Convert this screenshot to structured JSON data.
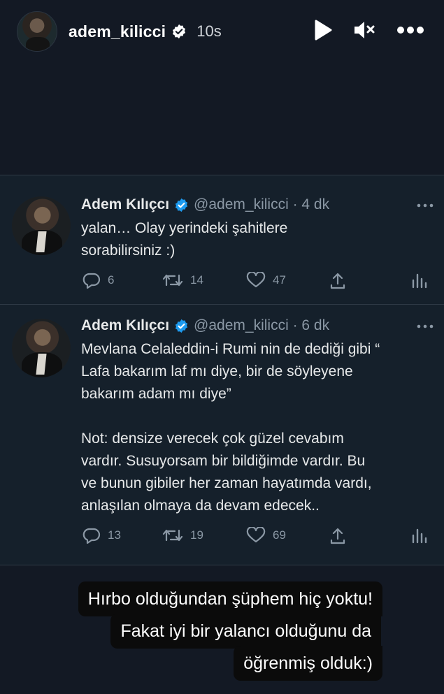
{
  "story": {
    "username": "adem_kilicci",
    "time": "10s",
    "icons": [
      "play-icon",
      "mute-icon",
      "more-options-icon"
    ]
  },
  "tweets": [
    {
      "name": "Adem Kılıçcı",
      "handle_time": "@adem_kilicci · 4 dk",
      "text": "yalan… Olay yerindeki şahitlere\nsorabilirsiniz :)",
      "replies": "6",
      "retweets": "14",
      "likes": "47"
    },
    {
      "name": "Adem Kılıçcı",
      "handle_time": "@adem_kilicci · 6 dk",
      "text": "Mevlana Celaleddin-i Rumi nin de dediği gibi “\nLafa bakarım laf mı diye, bir de söyleyene\nbakarım adam mı diye”\n\nNot: densize verecek çok güzel cevabım\nvardır. Susuyorsam bir bildiğimde vardır. Bu\nve bunun gibiler her zaman hayatımda vardı,\nanlaşılan olmaya da devam edecek..",
      "replies": "13",
      "retweets": "19",
      "likes": "69"
    }
  ],
  "caption": {
    "line1": "Hırbo olduğundan şüphem hiç yoktu!",
    "line2": "Fakat iyi  bir yalancı olduğunu da",
    "line3": "öğrenmiş olduk:)"
  },
  "colors": {
    "background": "#131924",
    "tweet_background": "#15202b",
    "verified": "#1d9bf0",
    "muted_text": "#8b98a5"
  }
}
